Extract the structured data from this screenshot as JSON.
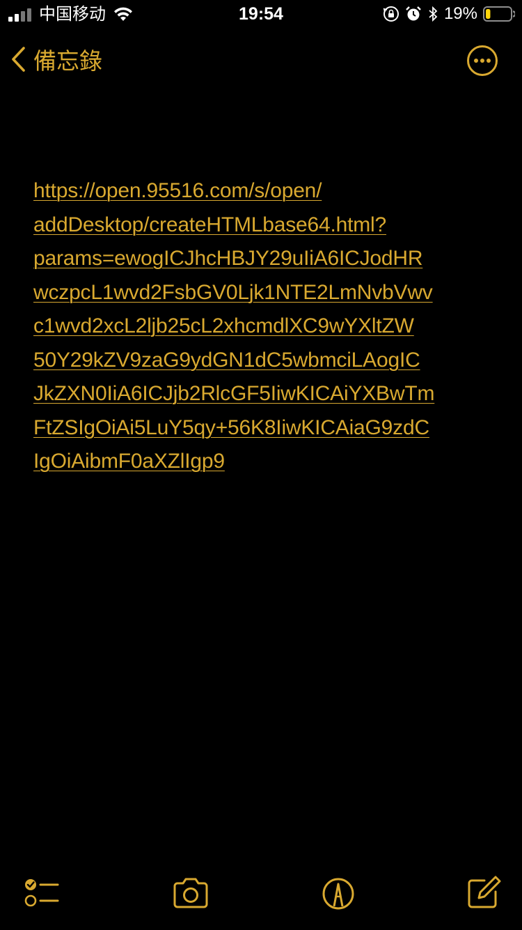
{
  "status_bar": {
    "carrier": "中国移动",
    "time": "19:54",
    "battery_percent": "19%",
    "battery_level": 0.19,
    "icons": [
      "signal-icon",
      "wifi-icon",
      "orientation-lock-icon",
      "alarm-icon",
      "bluetooth-icon",
      "battery-icon"
    ]
  },
  "nav": {
    "back_label": "備忘錄",
    "icons": [
      "chevron-left-icon",
      "more-icon"
    ]
  },
  "note": {
    "lines": [
      "https://open.95516.com/s/open/",
      "addDesktop/createHTMLbase64.html?",
      "params=ewogICJhcHBJY29uIiA6ICJodHR",
      "wczpcL1wvd2FsbGV0Ljk1NTE2LmNvbVwv",
      "c1wvd2xcL2ljb25cL2xhcmdlXC9wYXltZW",
      "50Y29kZV9zaG9ydGN1dC5wbmciLAogIC",
      "JkZXN0IiA6ICJjb2RlcGF5IiwKICAiYXBwTm",
      "FtZSIgOiAi5LuY5qy+56K8IiwKICAiaG9zdC",
      "IgOiAibmF0aXZlIgp9"
    ]
  },
  "toolbar": {
    "icons": [
      "checklist-icon",
      "camera-icon",
      "markup-icon",
      "compose-icon"
    ]
  },
  "colors": {
    "accent": "#d9a930",
    "background": "#000000"
  }
}
